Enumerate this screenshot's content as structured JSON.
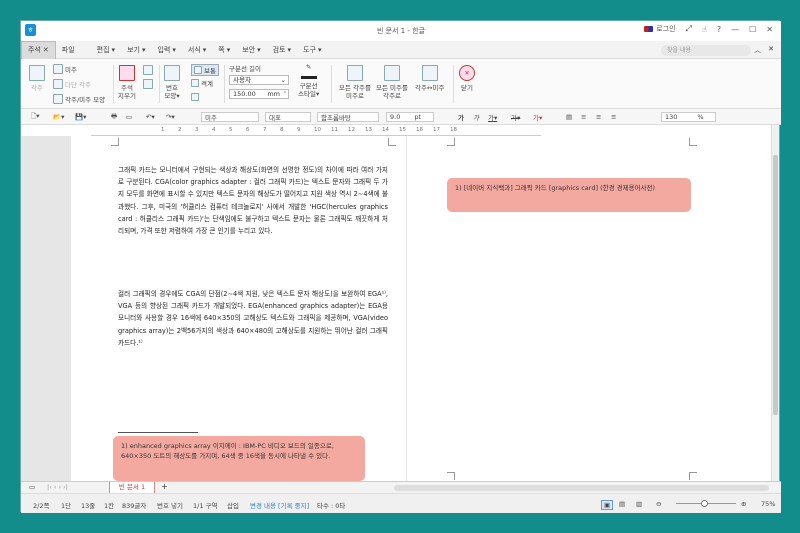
{
  "window": {
    "title": "빈 문서 1 - 한글",
    "login": "로그인",
    "controls": [
      "⤢",
      "⍰",
      "?",
      "—",
      "☐",
      "✕"
    ]
  },
  "menubar": {
    "items": [
      "주석",
      "파일",
      "편집",
      "보기",
      "입력",
      "서식",
      "쪽",
      "보안",
      "검토",
      "도구"
    ],
    "search_placeholder": "찾을 내용"
  },
  "ribbon": {
    "delete_comment": "지우기",
    "memo_small": [
      "미주",
      "다단 각주",
      "각주/미주 모양"
    ],
    "comment_label": "주석",
    "comment_label2": "지우기",
    "number_shape": "번호\n모양",
    "number_shape_l1": "번호",
    "number_shape_l2": "모양",
    "toggle_normal": "보통",
    "toggle_format": "격계",
    "sep_length_label": "구분선 길이",
    "sep_length_value": "사용자",
    "sep_length_mm": "150.00",
    "unit_mm": "mm",
    "sep_style_l1": "구분선",
    "sep_style_l2": "스타일",
    "all_footnotes_l1": "모든 각주를",
    "all_footnotes_l2": "미주로",
    "all_endnotes_l1": "모든 미주를",
    "all_endnotes_l2": "각주로",
    "footnote_endnote": "각주↔미주",
    "close": "닫기"
  },
  "toolbar2": {
    "style": "미주",
    "lang": "대표",
    "font": "함초롬바탕",
    "size": "9.0",
    "size_unit": "pt",
    "zoom": "130",
    "zoom_unit": "%"
  },
  "ruler": [
    "1",
    "2",
    "3",
    "4",
    "5",
    "6",
    "7",
    "8",
    "9",
    "10",
    "11",
    "12",
    "13",
    "14",
    "15",
    "16",
    "17",
    "18"
  ],
  "page1": {
    "para1": "그래픽 카드는 모니터에서 구현되는 색상과 해상도(화면의 선명한 정도)의 차이에 따라 여러 가지로 구분된다. CGA(color graphics adapter : 컬러 그래픽 카드)는 텍스트 문자와 그래픽 두 가지 모두를 화면에 표시할 수 있지만 텍스트 문자의 해상도가 떨어지고 지원 색상 역시 2∼4색에 불과했다. 그후, 미국의 '허큘리스 컴퓨터 테크놀로지' 사에서 개발한 'HGC(hercules graphics card : 허큘리스 그래픽 카드)'는 단색임에도 불구하고 텍스트 문자는 물론 그래픽도 깨끗하게 처리되며, 가격 또한 저렴하여 가장 큰 인기를 누리고 있다.",
    "para2": "컬러 그래픽의 경우에도 CGA의 단점(2∼4색 지원, 낮은 텍스트 문자 해상도)을 보완하여 EGA¹⁾, VGA 등의 향상된 그래픽 카드가 개발되었다. EGA(enhanced graphics adapter)는 EGA용 모니터와 사용할 경우 16색에 640×350의 고해상도 텍스트와 그래픽을 제공하며, VGA(video graphics array)는 2백56가지의 색상과 640×480의 고해상도를 지원하는 뛰어난 컬러 그래픽 카드다.¹⁾",
    "footnote": "1) enhanced graphics array 이지에이 : IBM-PC 비디오 보드의 일종으로, 640×350 도트의 해상도를 가지며, 64색 중 16색을 동시에 나타낼 수 있다."
  },
  "page2": {
    "memo": "1) [네이버 지식백과] 그래픽 카드 [graphics card] (한경 경제용어사전)"
  },
  "tabbar": {
    "doc_tab": "빈 문서 1",
    "add": "+"
  },
  "status": {
    "page": "2/2쪽",
    "section": "1단",
    "line": "13줄",
    "col": "1칸",
    "chars": "839글자",
    "insert_mode": "번호 넣기",
    "area": "1/1 구역",
    "insert": "삽입",
    "track": "변경 내용 [기록 중지]",
    "strokes": "타수 : 0타",
    "zoom": "75%"
  },
  "colors": {
    "memo_bg": "#f4a9a0",
    "desktop": "#138c8c",
    "accent": "#c33"
  }
}
